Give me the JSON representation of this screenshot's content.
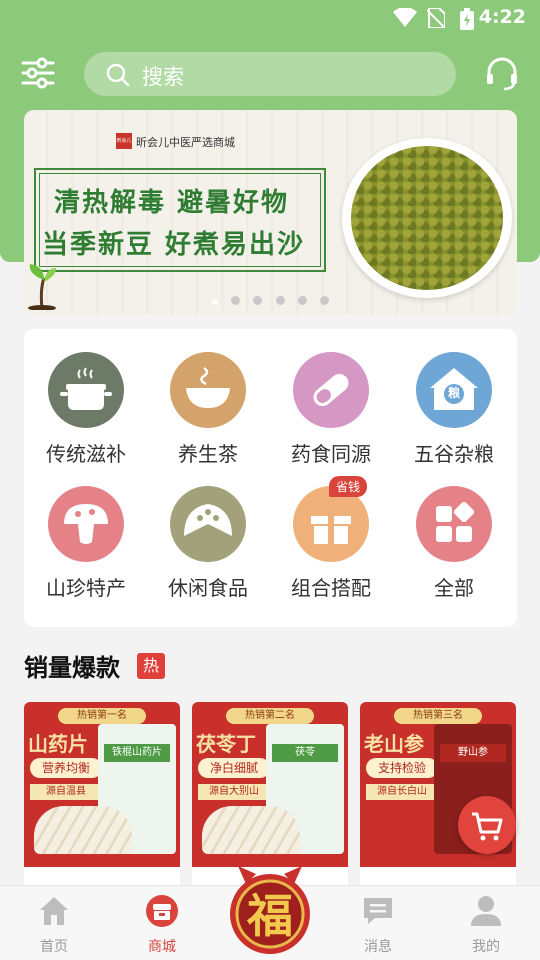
{
  "status": {
    "time": "4:22"
  },
  "header": {
    "search_placeholder": "搜索"
  },
  "banner": {
    "brand": "昕会儿中医严选商城",
    "brand_logo": "昕会儿",
    "line1": "清热解毒 避暑好物",
    "line2": "当季新豆 好煮易出沙",
    "dots": 6,
    "active_dot": 0
  },
  "categories": [
    {
      "label": "传统滋补",
      "icon": "pot-icon",
      "color": "#6d7a68"
    },
    {
      "label": "养生茶",
      "icon": "tea-bowl-icon",
      "color": "#d4a36b"
    },
    {
      "label": "药食同源",
      "icon": "capsule-icon",
      "color": "#d597c3"
    },
    {
      "label": "五谷杂粮",
      "icon": "grain-house-icon",
      "color": "#6ea6d6",
      "icon_text": "粮"
    },
    {
      "label": "山珍特产",
      "icon": "mushroom-icon",
      "color": "#e58288"
    },
    {
      "label": "休闲食品",
      "icon": "cheese-icon",
      "color": "#a2a17a"
    },
    {
      "label": "组合搭配",
      "icon": "gift-icon",
      "color": "#f0b07a",
      "badge": "省钱"
    },
    {
      "label": "全部",
      "icon": "grid-icon",
      "color": "#e58288"
    }
  ],
  "hot_section": {
    "title": "销量爆款",
    "badge": "热"
  },
  "products": [
    {
      "rank": "热销第一名",
      "name": "山药片",
      "feature": "营养均衡",
      "origin": "源自温县",
      "pack_label": "铁棍山药片"
    },
    {
      "rank": "热销第二名",
      "name": "茯苓丁",
      "feature": "净白细腻",
      "origin": "源自大别山",
      "pack_label": "茯苓"
    },
    {
      "rank": "热销第三名",
      "name": "老山参",
      "feature": "支持检验",
      "origin": "源自长白山",
      "pack_label": "野山参"
    }
  ],
  "tabbar": {
    "items": [
      {
        "label": "首页",
        "icon": "home-icon"
      },
      {
        "label": "商城",
        "icon": "shop-icon",
        "active": true
      },
      {
        "label": "福",
        "icon": "fu-icon"
      },
      {
        "label": "消息",
        "icon": "message-icon"
      },
      {
        "label": "我的",
        "icon": "profile-icon"
      }
    ]
  },
  "colors": {
    "theme_green": "#8cc97a",
    "accent_red": "#d9453c"
  }
}
